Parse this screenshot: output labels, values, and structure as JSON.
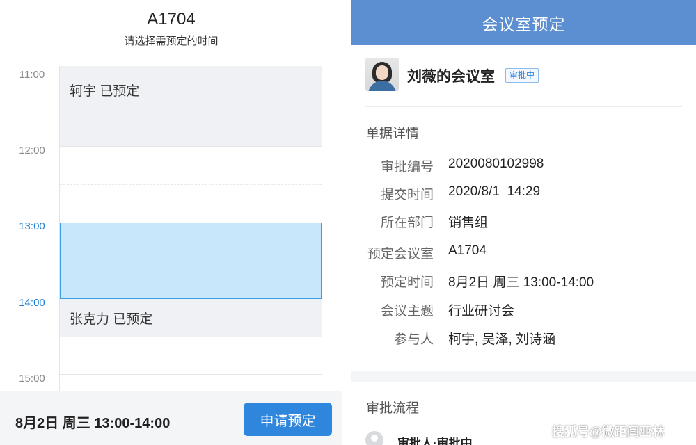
{
  "room_picker": {
    "room_name": "A1704",
    "subtitle": "请选择需预定的时间",
    "time_labels": [
      {
        "label": "11:00",
        "active": false
      },
      {
        "label": "12:00",
        "active": false
      },
      {
        "label": "13:00",
        "active": true
      },
      {
        "label": "14:00",
        "active": true
      },
      {
        "label": "15:00",
        "active": false
      }
    ],
    "bookings": [
      {
        "text": "轲宇 已预定"
      },
      {
        "text": "张克力 已预定"
      }
    ],
    "selection_summary": "8月2日 周三 13:00-14:00",
    "apply_button": "申请预定"
  },
  "detail": {
    "header_title": "会议室预定",
    "owner_name": "刘薇的会议室",
    "status_badge": "审批中",
    "section_details_title": "单据详情",
    "fields": [
      {
        "label": "审批编号",
        "value": "2020080102998"
      },
      {
        "label": "提交时间",
        "value": "2020/8/1  14:29"
      },
      {
        "label": "所在部门",
        "value": "销售组"
      },
      {
        "label": "预定会议室",
        "value": "A1704"
      },
      {
        "label": "预定时间",
        "value": "8月2日 周三 13:00-14:00"
      },
      {
        "label": "会议主题",
        "value": "行业研讨会"
      },
      {
        "label": "参与人",
        "value": "柯宇, 吴泽, 刘诗涵"
      }
    ],
    "section_flow_title": "审批流程",
    "flow_step": "审批人·审批中"
  },
  "watermark": "搜狐号@微距闫亚林",
  "colors": {
    "accent": "#2f86dd",
    "header_bg": "#5b8fd2",
    "selection_fill": "#c9e7fb",
    "booked_fill": "#eff1f5",
    "active_time": "#1a7fd4"
  }
}
